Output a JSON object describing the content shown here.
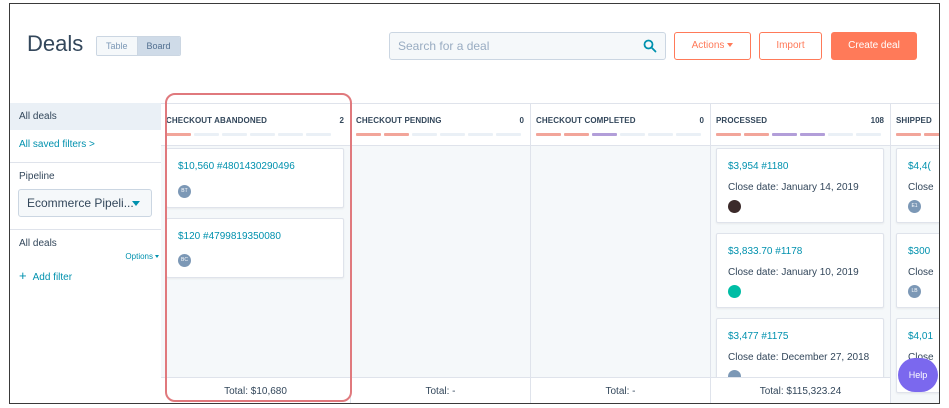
{
  "header": {
    "title": "Deals",
    "view_toggle": [
      "Table",
      "Board"
    ],
    "search_placeholder": "Search for a deal",
    "actions_label": "Actions",
    "import_label": "Import",
    "create_label": "Create deal"
  },
  "sidebar": {
    "all_deals": "All deals",
    "saved_filters": "All saved filters >",
    "pipeline_label": "Pipeline",
    "pipeline_value": "Ecommerce Pipeli...",
    "all_deals_2": "All deals",
    "options": "Options",
    "add_filter": "Add filter"
  },
  "board": {
    "columns": [
      {
        "name": "CHECKOUT ABANDONED",
        "count": "2",
        "total": "Total: $10,680",
        "cards": [
          {
            "title": "$10,560 #4801430290496",
            "avatar": "BT"
          },
          {
            "title": "$120 #4799819350080",
            "avatar": "BC"
          }
        ]
      },
      {
        "name": "CHECKOUT PENDING",
        "count": "0",
        "total": "Total: -"
      },
      {
        "name": "CHECKOUT COMPLETED",
        "count": "0",
        "total": "Total: -"
      },
      {
        "name": "PROCESSED",
        "count": "108",
        "total": "Total: $115,323.24",
        "cards": [
          {
            "title": "$3,954 #1180",
            "close": "Close date: January 14, 2019"
          },
          {
            "title": "$3,833.70 #1178",
            "close": "Close date: January 10, 2019"
          },
          {
            "title": "$3,477 #1175",
            "close": "Close date: December 27, 2018"
          }
        ]
      },
      {
        "name": "SHIPPED",
        "cards": [
          {
            "title": "$4,4(",
            "close": "Close",
            "avatar": "E1"
          },
          {
            "title": "$300",
            "close": "Close",
            "avatar": "LB"
          },
          {
            "title": "$4,01",
            "close": "Close"
          }
        ]
      }
    ]
  },
  "help_label": "Help",
  "colors": {
    "accent": "#ff7a59",
    "link": "#0091ae",
    "bar_orange": "#f2a59a",
    "bar_purple": "#b29ed9",
    "highlight": "#e0797d"
  }
}
